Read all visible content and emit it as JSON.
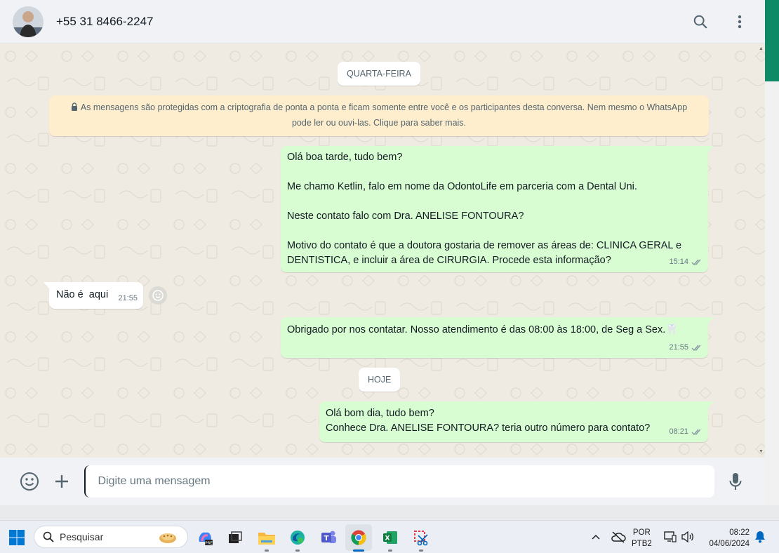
{
  "header": {
    "contact": "+55 31 8466-2247",
    "search_icon": "search-icon",
    "menu_icon": "kebab-menu-icon"
  },
  "chat": {
    "day_wednesday": "QUARTA-FEIRA",
    "e2e_notice": "As mensagens são protegidas com a criptografia de ponta a ponta e ficam somente entre você e os participantes desta conversa. Nem mesmo o WhatsApp pode ler ou ouvi-las. Clique para saber mais.",
    "msg1": {
      "p1": "Olá boa tarde, tudo bem?",
      "p2": "Me chamo Ketlin, falo em nome da OdontoLife em parceria com a Dental Uni.",
      "p3": "Neste contato falo com Dra. ANELISE FONTOURA?",
      "p4": "Motivo do contato é que a doutora gostaria de remover as áreas de: CLINICA GERAL e DENTISTICA, e incluir a área de CIRURGIA. Procede esta informação?",
      "time": "15:14"
    },
    "msg2": {
      "text": "Não é  aqui",
      "time": "21:55"
    },
    "msg3": {
      "text": "Obrigado por nos contatar. Nosso atendimento é das 08:00 às 18:00, de Seg a Sex.",
      "emoji": "🦷",
      "time": "21:55"
    },
    "day_today": "HOJE",
    "msg4": {
      "line1": "Olá bom dia, tudo bem?",
      "line2": "Conhece Dra. ANELISE FONTOURA? teria outro número para contato?",
      "time": "08:21"
    }
  },
  "composer": {
    "placeholder": "Digite uma mensagem",
    "emoji_icon": "emoji-icon",
    "attach_icon": "plus-icon",
    "mic_icon": "microphone-icon"
  },
  "taskbar": {
    "search_label": "Pesquisar",
    "lang_line1": "POR",
    "lang_line2": "PTB2",
    "time": "08:22",
    "date": "04/06/2024",
    "colors": {
      "accent": "#0067c0",
      "whatsapp_green": "#0e8a67",
      "bubble_out": "#d9fdd3"
    }
  }
}
